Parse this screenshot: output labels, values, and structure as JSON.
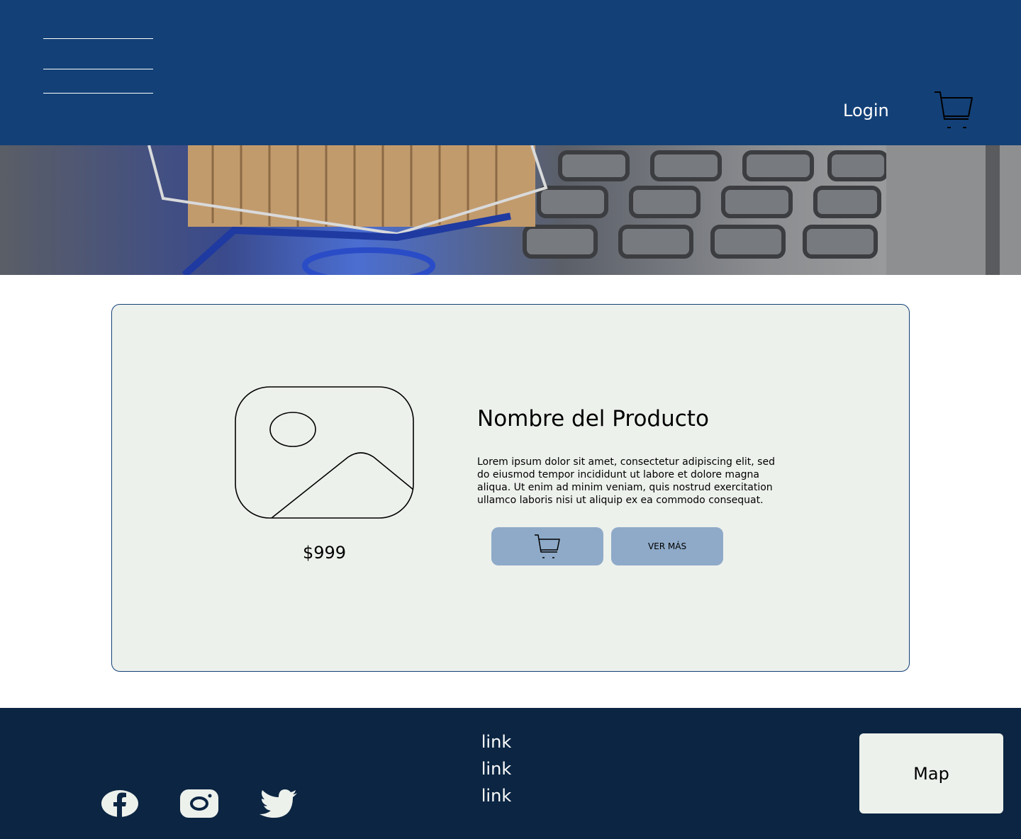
{
  "header": {
    "login_label": "Login",
    "menu_icon": "hamburger-menu-icon",
    "cart_icon": "cart-icon"
  },
  "hero": {
    "image": "shopping-cart-on-laptop-keyboard"
  },
  "product": {
    "name": "Nombre del Producto",
    "description": "Lorem ipsum dolor sit amet, consectetur adipiscing elit, sed do eiusmod tempor incididunt ut labore et dolore magna aliqua. Ut enim ad minim veniam, quis nostrud exercitation ullamco laboris nisi ut aliquip ex ea commodo consequat.",
    "price": "$999",
    "image_icon": "image-placeholder-icon",
    "add_to_cart_icon": "cart-icon",
    "see_more_label": "VER MÁS"
  },
  "footer": {
    "social": [
      "facebook-icon",
      "instagram-icon",
      "twitter-icon"
    ],
    "links": [
      "link",
      "link",
      "link"
    ],
    "map_label": "Map"
  },
  "colors": {
    "header_bg": "#134077",
    "footer_bg": "#0b2542",
    "card_bg": "#edf1ec",
    "button_bg": "#8eaac8"
  }
}
